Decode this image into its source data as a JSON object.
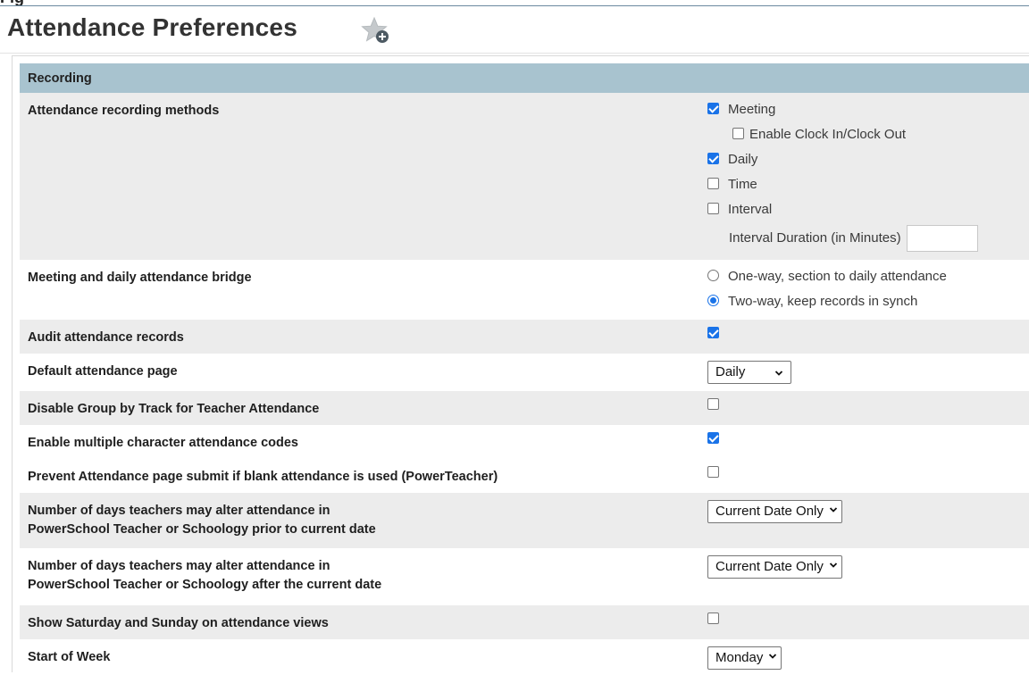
{
  "page": {
    "title": "Attendance Preferences",
    "favorite_icon": "star-plus-icon",
    "accent_color": "#1a73e8",
    "section_header_color": "#a8c3cf",
    "row_alt_color": "#ececec"
  },
  "section": {
    "title": "Recording"
  },
  "recording_methods": {
    "label": "Attendance recording methods",
    "meeting": {
      "label": "Meeting",
      "checked": true
    },
    "clock": {
      "label": "Enable Clock In/Clock Out",
      "checked": false
    },
    "daily": {
      "label": "Daily",
      "checked": true
    },
    "time": {
      "label": "Time",
      "checked": false
    },
    "interval": {
      "label": "Interval",
      "checked": false
    },
    "interval_duration": {
      "label": "Interval Duration (in Minutes)",
      "value": ""
    }
  },
  "bridge": {
    "label": "Meeting and daily attendance bridge",
    "options": [
      {
        "label": "One-way, section to daily attendance",
        "selected": false
      },
      {
        "label": "Two-way, keep records in synch",
        "selected": true
      }
    ]
  },
  "audit": {
    "label": "Audit attendance records",
    "checked": true
  },
  "default_page": {
    "label": "Default attendance page",
    "value": "Daily"
  },
  "disable_group": {
    "label": "Disable Group by Track for Teacher Attendance",
    "checked": false
  },
  "multi_char": {
    "label": "Enable multiple character attendance codes",
    "checked": true
  },
  "prevent_submit": {
    "label": "Prevent Attendance page submit if blank attendance is used (PowerTeacher)",
    "checked": false
  },
  "days_prior": {
    "label_line1": "Number of days teachers may alter attendance in",
    "label_line2": "PowerSchool Teacher or Schoology prior to current date",
    "value": "Current Date Only"
  },
  "days_after": {
    "label_line1": "Number of days teachers may alter attendance in",
    "label_line2": "PowerSchool Teacher or Schoology after the current date",
    "value": "Current Date Only"
  },
  "weekend": {
    "label": "Show Saturday and Sunday on attendance views",
    "checked": false
  },
  "start_week": {
    "label": "Start of Week",
    "value": "Monday"
  }
}
